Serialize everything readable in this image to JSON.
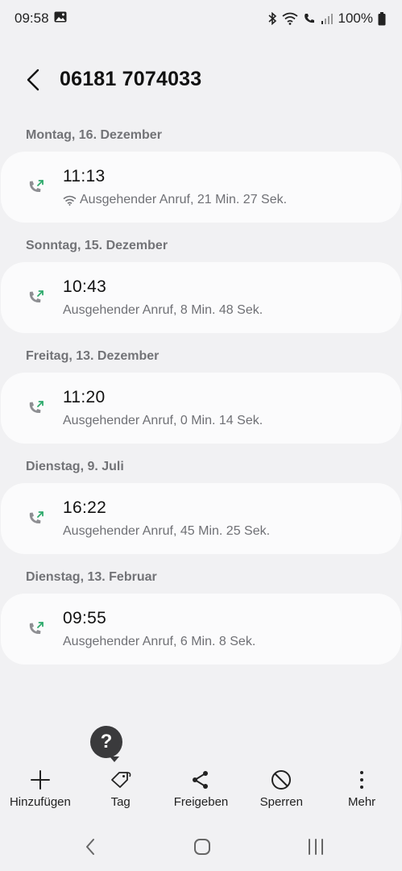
{
  "status_bar": {
    "time": "09:58",
    "battery": "100%"
  },
  "header": {
    "title": "06181 7074033"
  },
  "groups": [
    {
      "date": "Montag, 16. Dezember",
      "time": "11:13",
      "detail": "Ausgehender Anruf, 21 Min. 27 Sek.",
      "wifi_call": true
    },
    {
      "date": "Sonntag, 15. Dezember",
      "time": "10:43",
      "detail": "Ausgehender Anruf, 8 Min. 48 Sek.",
      "wifi_call": false
    },
    {
      "date": "Freitag, 13. Dezember",
      "time": "11:20",
      "detail": "Ausgehender Anruf, 0 Min. 14 Sek.",
      "wifi_call": false
    },
    {
      "date": "Dienstag, 9. Juli",
      "time": "16:22",
      "detail": "Ausgehender Anruf, 45 Min. 25 Sek.",
      "wifi_call": false
    },
    {
      "date": "Dienstag, 13. Februar",
      "time": "09:55",
      "detail": "Ausgehender Anruf, 6 Min. 8 Sek.",
      "wifi_call": false
    }
  ],
  "help": {
    "label": "?"
  },
  "actions": {
    "add": "Hinzufügen",
    "tag": "Tag",
    "share": "Freigeben",
    "block": "Sperren",
    "more": "Mehr"
  },
  "colors": {
    "background": "#f1f1f3",
    "card": "#fbfbfc",
    "accent_green": "#2eaa6c",
    "date_gray": "#727377"
  }
}
